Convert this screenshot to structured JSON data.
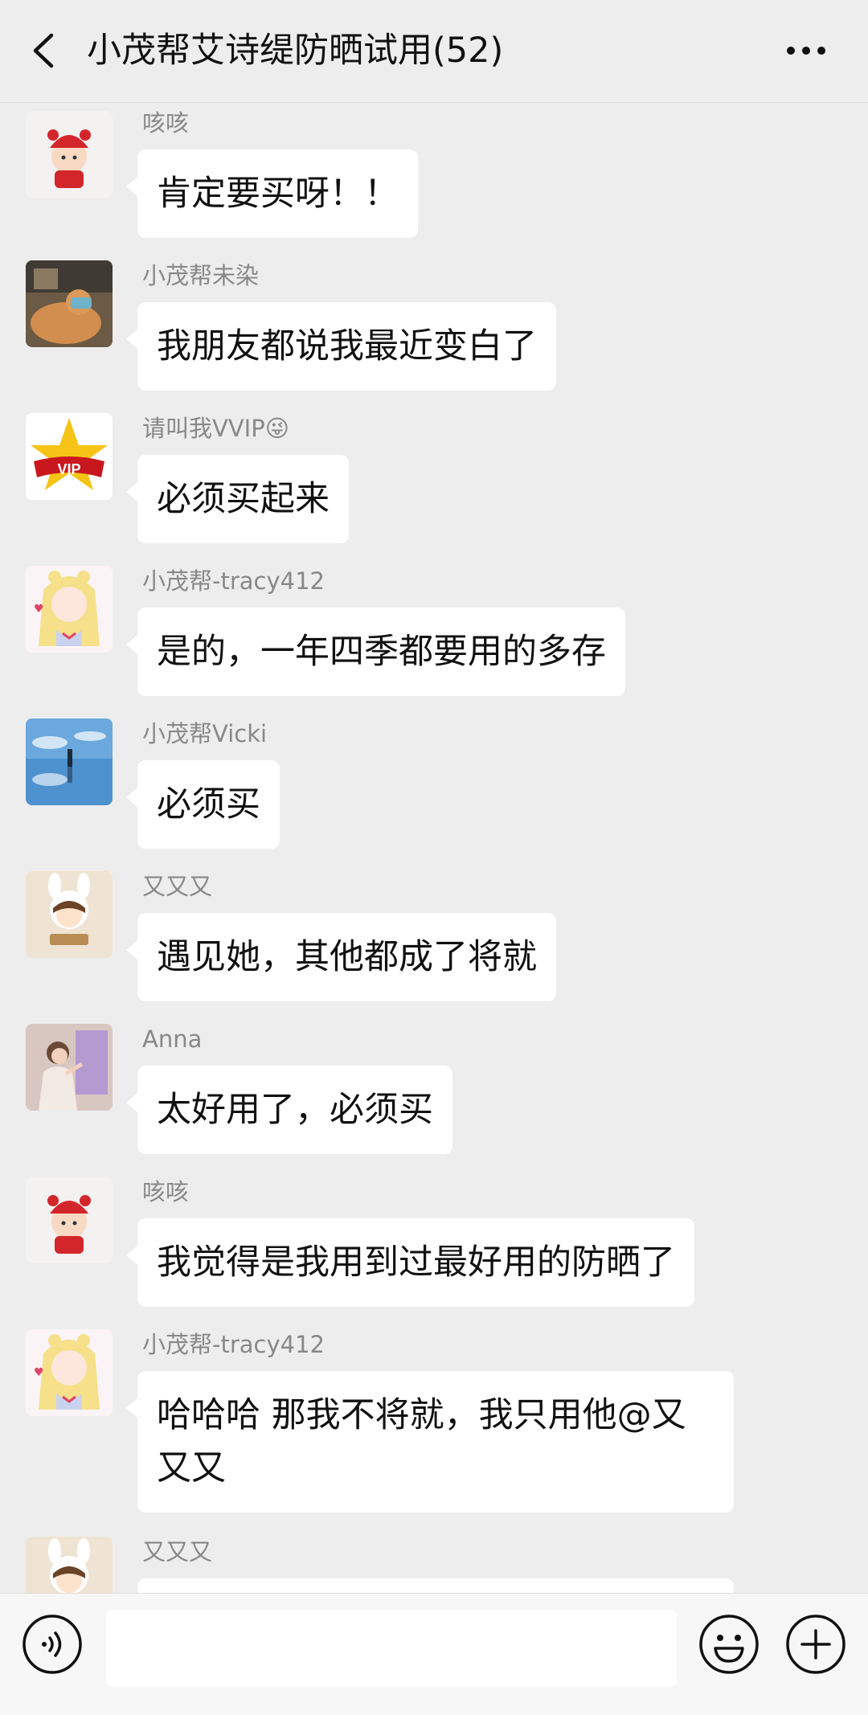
{
  "header": {
    "title": "小茂帮艾诗缇防晒试用(52)",
    "back_icon": "chevron-left-icon",
    "more_icon": "more-dots-icon"
  },
  "messages": [
    {
      "sender": "咳咳",
      "text": "肯定要买呀！！",
      "avatar": "girl-red-hat-avatar"
    },
    {
      "sender": "小茂帮未染",
      "text": "我朋友都说我最近变白了",
      "avatar": "photo-cat-avatar"
    },
    {
      "sender": "请叫我VVIP😜",
      "text": "必须买起来",
      "avatar": "vip-star-avatar"
    },
    {
      "sender": "小茂帮-tracy412",
      "text": "是的，一年四季都要用的多存",
      "avatar": "anime-girl-avatar"
    },
    {
      "sender": "小茂帮Vicki",
      "text": "必须买",
      "avatar": "sky-reflection-avatar"
    },
    {
      "sender": "又又又",
      "text": "遇见她，其他都成了将就",
      "avatar": "bunny-girl-avatar"
    },
    {
      "sender": "Anna",
      "text": "太好用了，必须买",
      "avatar": "painting-girl-avatar"
    },
    {
      "sender": "咳咳",
      "text": "我觉得是我用到过最好用的防晒了",
      "avatar": "girl-red-hat-avatar"
    },
    {
      "sender": "小茂帮-tracy412",
      "text": "哈哈哈 那我不将就，我只用他@又又又",
      "avatar": "anime-girl-avatar"
    },
    {
      "sender": "又又又",
      "text": "",
      "avatar": "bunny-girl-avatar"
    }
  ],
  "input_bar": {
    "voice_icon": "voice-icon",
    "input_value": "",
    "emoji_icon": "emoji-icon",
    "plus_icon": "plus-icon"
  },
  "colors": {
    "background": "#ededed",
    "bubble": "#ffffff",
    "sender_text": "#888888"
  }
}
